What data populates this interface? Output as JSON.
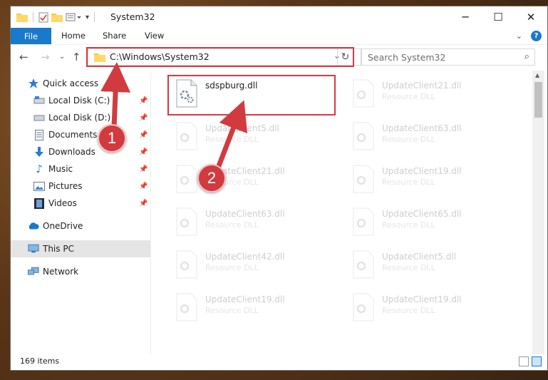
{
  "window": {
    "title": "System32",
    "controls": {
      "minimize": "─",
      "maximize": "☐",
      "close": "✕"
    }
  },
  "ribbon": {
    "tabs": [
      {
        "label": "File"
      },
      {
        "label": "Home"
      },
      {
        "label": "Share"
      },
      {
        "label": "View"
      }
    ]
  },
  "address": {
    "path": "C:\\Windows\\System32",
    "search_placeholder": "Search System32"
  },
  "nav": {
    "items": [
      {
        "label": "Quick access",
        "icon": "star-icon"
      },
      {
        "label": "Local Disk (C:)",
        "icon": "drive-icon",
        "pinned": true
      },
      {
        "label": "Local Disk (D:)",
        "icon": "drive-icon",
        "pinned": true
      },
      {
        "label": "Documents",
        "icon": "document-icon",
        "pinned": true
      },
      {
        "label": "Downloads",
        "icon": "download-icon",
        "pinned": true
      },
      {
        "label": "Music",
        "icon": "music-icon",
        "pinned": true
      },
      {
        "label": "Pictures",
        "icon": "pictures-icon",
        "pinned": true
      },
      {
        "label": "Videos",
        "icon": "video-icon",
        "pinned": true
      },
      {
        "label": "OneDrive",
        "icon": "cloud-icon"
      },
      {
        "label": "This PC",
        "icon": "computer-icon",
        "selected": true
      },
      {
        "label": "Network",
        "icon": "network-icon"
      }
    ]
  },
  "files": [
    {
      "name": "sdspburg.dll",
      "type": "",
      "highlighted": true
    },
    {
      "name": "UpdateClient21.dll",
      "type": "Resource DLL"
    },
    {
      "name": "UpdateClient5.dll",
      "type": "Resource DLL"
    },
    {
      "name": "UpdateClient63.dll",
      "type": "Resource DLL"
    },
    {
      "name": "UpdateClient21.dll",
      "type": "Resource DLL"
    },
    {
      "name": "UpdateClient19.dll",
      "type": "Resource DLL"
    },
    {
      "name": "UpdateClient63.dll",
      "type": "Resource DLL"
    },
    {
      "name": "UpdateClient65.dll",
      "type": "Resource DLL"
    },
    {
      "name": "UpdateClient42.dll",
      "type": "Resource DLL"
    },
    {
      "name": "UpdateClient5.dll",
      "type": "Resource DLL"
    },
    {
      "name": "UpdateClient19.dll",
      "type": "Resource DLL"
    },
    {
      "name": "UpdateClient19.dll",
      "type": "Resource DLL"
    }
  ],
  "status": {
    "item_count": "169 items"
  },
  "annotations": {
    "step1": "1",
    "step2": "2",
    "color": "#d13b3f"
  },
  "colors": {
    "accent": "#1979ca",
    "highlight": "#d9393e"
  }
}
